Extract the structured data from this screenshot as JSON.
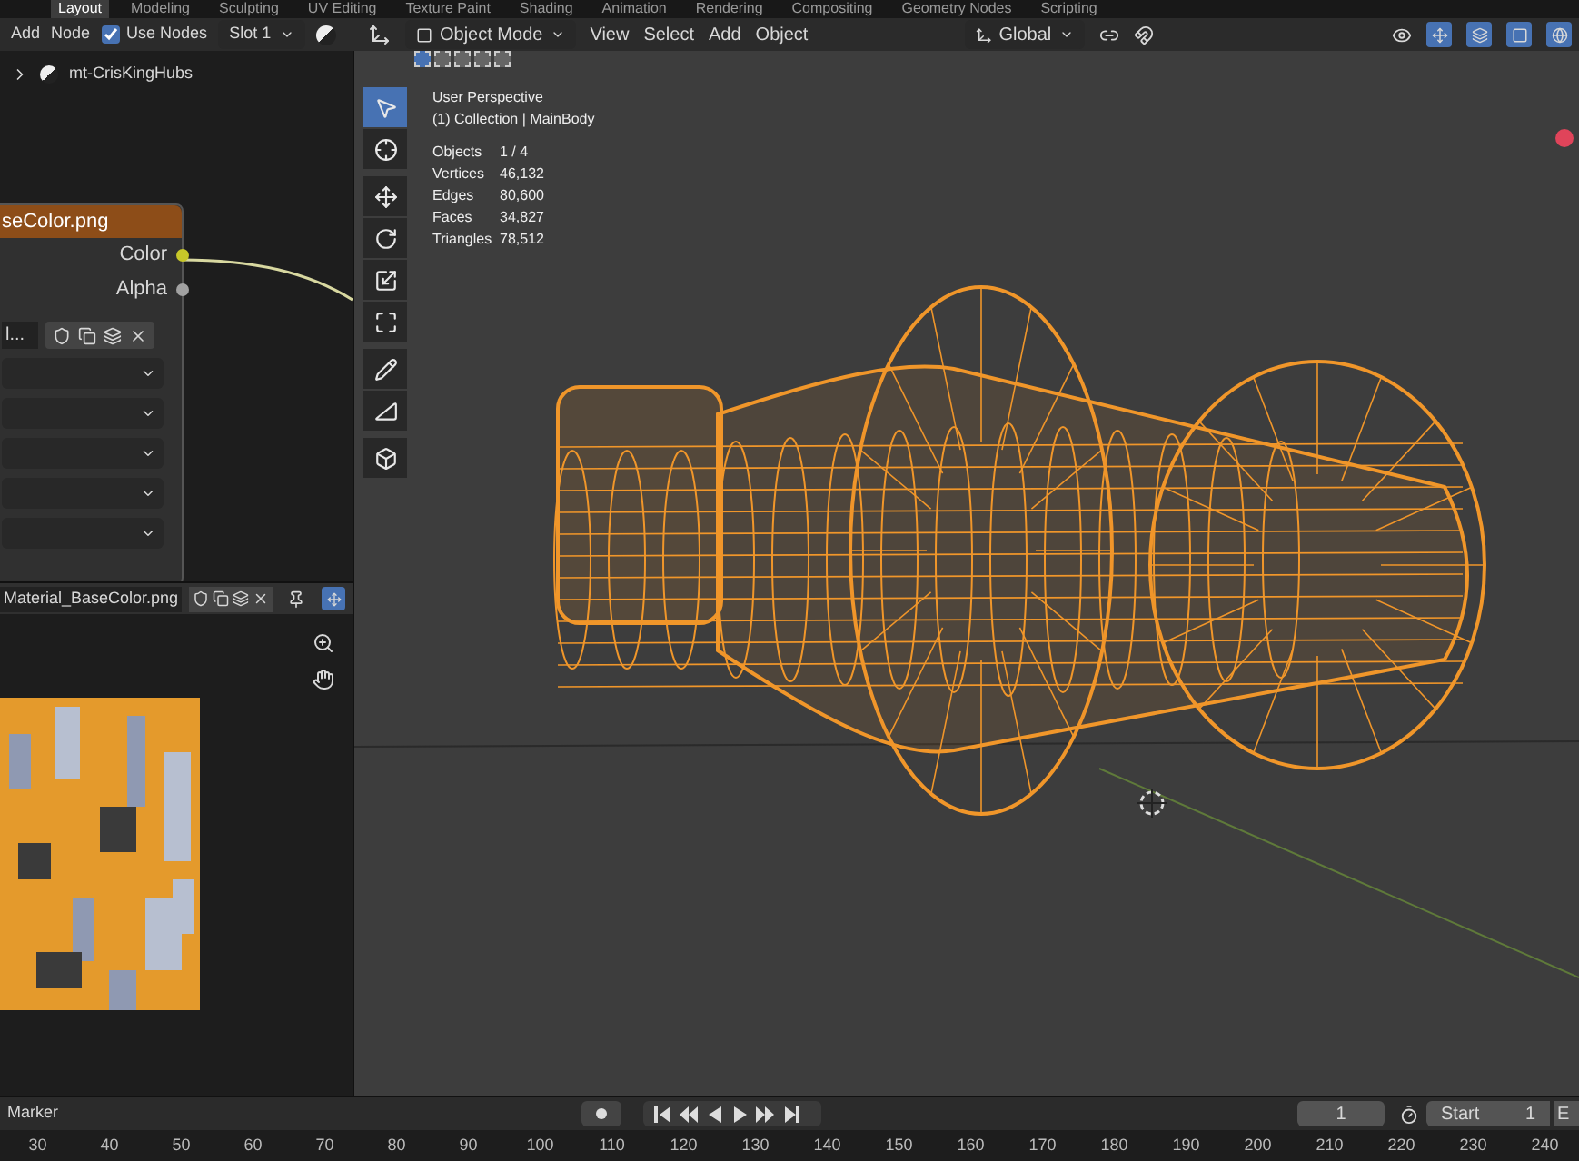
{
  "workspace_tabs": [
    {
      "label": "Layout",
      "selected": true
    },
    {
      "label": "Modeling",
      "selected": false
    },
    {
      "label": "Sculpting",
      "selected": false
    },
    {
      "label": "UV Editing",
      "selected": false
    },
    {
      "label": "Texture Paint",
      "selected": false
    },
    {
      "label": "Shading",
      "selected": false
    },
    {
      "label": "Animation",
      "selected": false
    },
    {
      "label": "Rendering",
      "selected": false
    },
    {
      "label": "Compositing",
      "selected": false
    },
    {
      "label": "Geometry Nodes",
      "selected": false
    },
    {
      "label": "Scripting",
      "selected": false
    }
  ],
  "node_editor": {
    "menu": [
      "Add",
      "Node"
    ],
    "use_nodes": {
      "label": "Use Nodes",
      "checked": true
    },
    "slot": "Slot 1",
    "breadcrumb": "mt-CrisKingHubs",
    "node": {
      "title": "seColor.png",
      "outputs": [
        {
          "label": "Color",
          "linked": true
        },
        {
          "label": "Alpha",
          "linked": false
        }
      ],
      "image_field": "l..."
    }
  },
  "image_editor": {
    "image_name": "Material_BaseColor.png"
  },
  "viewport": {
    "mode": "Object Mode",
    "menu": [
      "View",
      "Select",
      "Add",
      "Object"
    ],
    "orientation": "Global",
    "overlay_title": "User Perspective",
    "collection": "(1) Collection | MainBody",
    "stats": [
      {
        "label": "Objects",
        "value": "1 / 4"
      },
      {
        "label": "Vertices",
        "value": "46,132"
      },
      {
        "label": "Edges",
        "value": "80,600"
      },
      {
        "label": "Faces",
        "value": "34,827"
      },
      {
        "label": "Triangles",
        "value": "78,512"
      }
    ],
    "tools": [
      {
        "selected": true
      },
      {
        "selected": false
      },
      {
        "selected": false
      },
      {
        "selected": false
      },
      {
        "selected": false
      },
      {
        "selected": false
      },
      {
        "selected": false
      },
      {
        "selected": false
      },
      {
        "selected": false
      }
    ]
  },
  "timeline": {
    "menu": "Marker",
    "current_frame": "1",
    "start_label": "Start",
    "start": "1",
    "end_label": "E",
    "ruler": [
      "30",
      "40",
      "50",
      "60",
      "70",
      "80",
      "90",
      "100",
      "110",
      "120",
      "130",
      "140",
      "150",
      "160",
      "170",
      "180",
      "190",
      "200",
      "210",
      "220",
      "230",
      "240"
    ]
  }
}
